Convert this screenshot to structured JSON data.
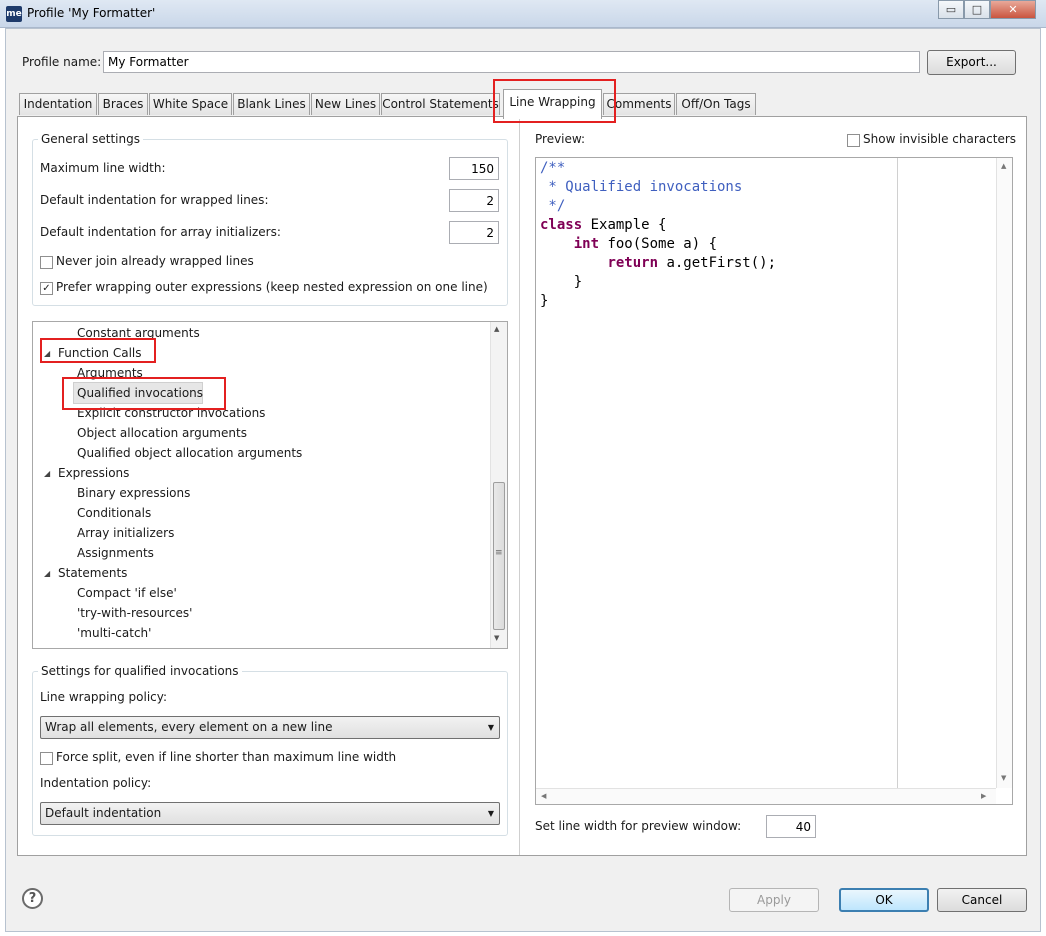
{
  "window": {
    "icon_text": "me",
    "title": "Profile 'My Formatter'",
    "minimize": "▭",
    "maximize": "□",
    "close": "✕"
  },
  "profile": {
    "name_label": "Profile name:",
    "name_value": "My Formatter",
    "export_label": "Export..."
  },
  "tabs": [
    {
      "label": "Indentation"
    },
    {
      "label": "Braces"
    },
    {
      "label": "White Space"
    },
    {
      "label": "Blank Lines"
    },
    {
      "label": "New Lines"
    },
    {
      "label": "Control Statements"
    },
    {
      "label": "Line Wrapping",
      "active": true
    },
    {
      "label": "Comments"
    },
    {
      "label": "Off/On Tags"
    }
  ],
  "general": {
    "title": "General settings",
    "max_width_label": "Maximum line width:",
    "max_width_value": "150",
    "wrap_indent_label": "Default indentation for wrapped lines:",
    "wrap_indent_value": "2",
    "array_indent_label": "Default indentation for array initializers:",
    "array_indent_value": "2",
    "never_join_label": "Never join already wrapped lines",
    "never_join_checked": false,
    "prefer_outer_label": "Prefer wrapping outer expressions (keep nested expression on one line)",
    "prefer_outer_checked": true
  },
  "tree": {
    "rows": [
      {
        "label": "Constant arguments",
        "level": 1
      },
      {
        "label": "Function Calls",
        "level": 0,
        "expanded": true
      },
      {
        "label": "Arguments",
        "level": 1
      },
      {
        "label": "Qualified invocations",
        "level": 1,
        "selected": true
      },
      {
        "label": "Explicit constructor invocations",
        "level": 1
      },
      {
        "label": "Object allocation arguments",
        "level": 1
      },
      {
        "label": "Qualified object allocation arguments",
        "level": 1
      },
      {
        "label": "Expressions",
        "level": 0,
        "expanded": true
      },
      {
        "label": "Binary expressions",
        "level": 1
      },
      {
        "label": "Conditionals",
        "level": 1
      },
      {
        "label": "Array initializers",
        "level": 1
      },
      {
        "label": "Assignments",
        "level": 1
      },
      {
        "label": "Statements",
        "level": 0,
        "expanded": true
      },
      {
        "label": "Compact 'if else'",
        "level": 1
      },
      {
        "label": "'try-with-resources'",
        "level": 1
      },
      {
        "label": "'multi-catch'",
        "level": 1
      }
    ],
    "expander_glyph": "◢"
  },
  "qualified": {
    "title": "Settings for qualified invocations",
    "policy_label": "Line wrapping policy:",
    "policy_value": "Wrap all elements, every element on a new line",
    "force_split_label": "Force split, even if line shorter than maximum line width",
    "force_split_checked": false,
    "indent_label": "Indentation policy:",
    "indent_value": "Default indentation"
  },
  "preview": {
    "label": "Preview:",
    "show_invisible_label": "Show invisible characters",
    "show_invisible_checked": false,
    "code_lines": [
      [
        {
          "t": "/**",
          "c": "cm"
        }
      ],
      [
        {
          "t": " * Qualified invocations",
          "c": "cm"
        }
      ],
      [
        {
          "t": " */",
          "c": "cm"
        }
      ],
      [
        {
          "t": "class",
          "c": "kw"
        },
        {
          "t": " Example {",
          "c": ""
        }
      ],
      [
        {
          "t": "    ",
          "c": ""
        },
        {
          "t": "int",
          "c": "kw"
        },
        {
          "t": " foo(Some a) {",
          "c": ""
        }
      ],
      [
        {
          "t": "        ",
          "c": ""
        },
        {
          "t": "return",
          "c": "kw"
        },
        {
          "t": " a.getFirst();",
          "c": ""
        }
      ],
      [
        {
          "t": "    }",
          "c": ""
        }
      ],
      [
        {
          "t": "}",
          "c": ""
        }
      ]
    ],
    "line_width_label": "Set line width for preview window:",
    "line_width_value": "40"
  },
  "footer": {
    "help_glyph": "?",
    "apply_label": "Apply",
    "ok_label": "OK",
    "cancel_label": "Cancel"
  },
  "glyphs": {
    "check": "✓",
    "arrow_up": "▲",
    "arrow_down": "▼",
    "arrow_left": "◀",
    "arrow_right": "▶",
    "grip": "≡",
    "dropdown": "▼"
  },
  "colors": {
    "highlight_box": "#e32020",
    "comment": "#3f5fbf",
    "keyword": "#7f0055",
    "ok_border": "#3c7fb1"
  }
}
